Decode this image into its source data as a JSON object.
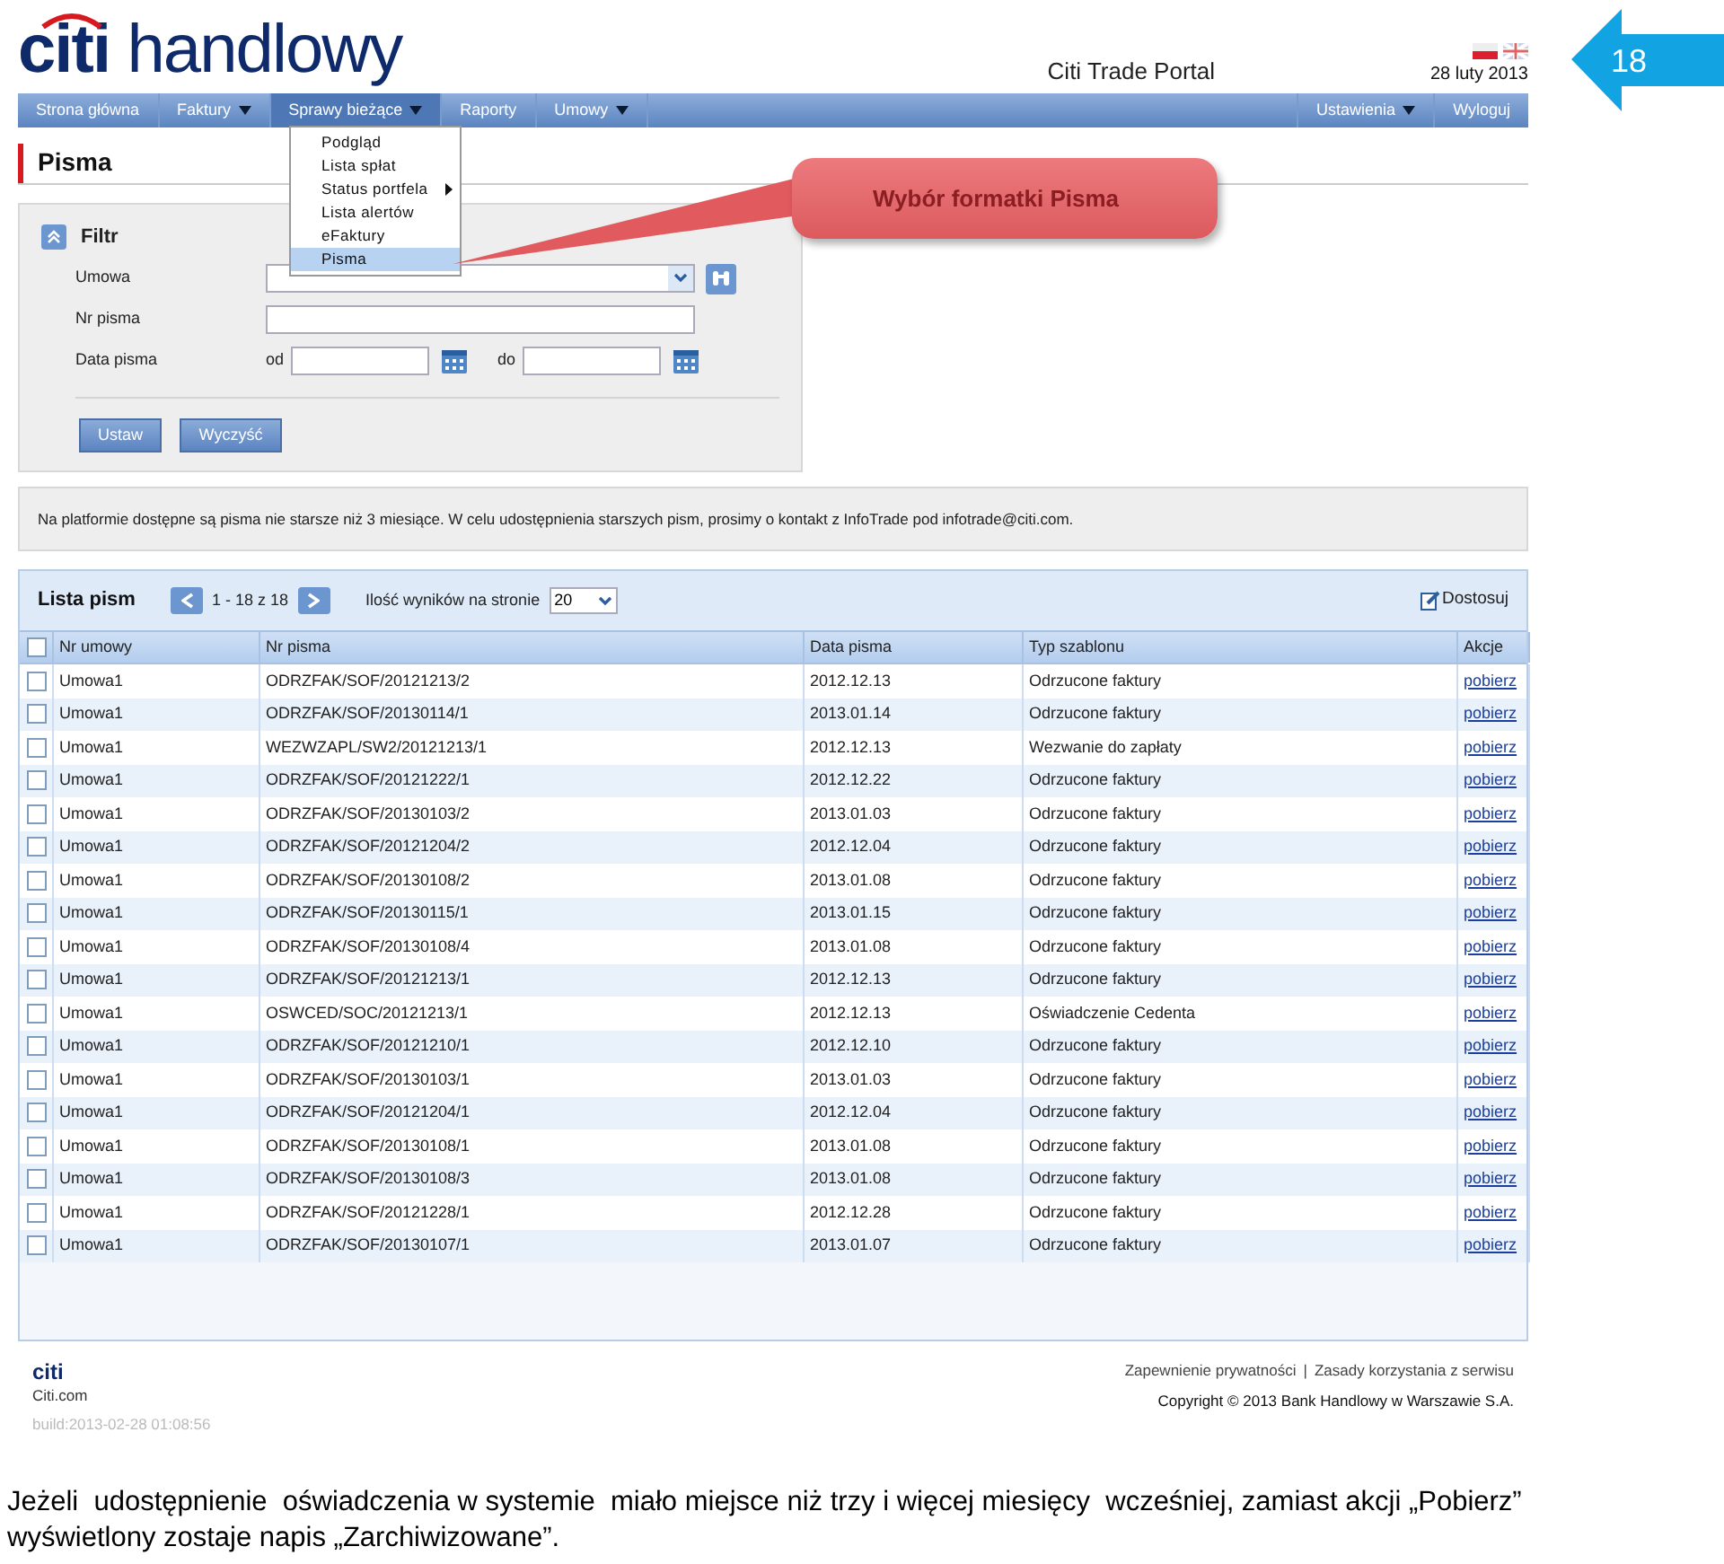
{
  "slide_number": "18",
  "logo": "**citi** handlowy",
  "portal_title": "Citi Trade Portal",
  "date": "28 luty 2013",
  "nav": [
    {
      "label": "Strona główna",
      "dropdown": false,
      "selected": false
    },
    {
      "label": "Faktury",
      "dropdown": true,
      "selected": false
    },
    {
      "label": "Sprawy bieżące",
      "dropdown": true,
      "selected": true
    },
    {
      "label": "Raporty",
      "dropdown": false,
      "selected": false
    },
    {
      "label": "Umowy",
      "dropdown": true,
      "selected": false
    }
  ],
  "nav_right": [
    {
      "label": "Ustawienia",
      "dropdown": true
    },
    {
      "label": "Wyloguj",
      "dropdown": false
    }
  ],
  "menu": [
    {
      "label": "Podgląd",
      "submenu": false,
      "selected": false
    },
    {
      "label": "Lista spłat",
      "submenu": false,
      "selected": false
    },
    {
      "label": "Status portfela",
      "submenu": true,
      "selected": false
    },
    {
      "label": "Lista alertów",
      "submenu": false,
      "selected": false
    },
    {
      "label": "eFaktury",
      "submenu": false,
      "selected": false
    },
    {
      "label": "Pisma",
      "submenu": false,
      "selected": true
    }
  ],
  "callout": "Wybór formatki Pisma",
  "page_title": "Pisma",
  "filter": {
    "title": "Filtr",
    "umowa_label": "Umowa",
    "nr_label": "Nr pisma",
    "date_label": "Data pisma",
    "from_label": "od",
    "to_label": "do",
    "buttons": [
      "Ustaw",
      "Wyczyść"
    ]
  },
  "info": "Na platformie dostępne są pisma nie starsze niż 3 miesiące. W celu udostępnienia starszych pism, prosimy o kontakt z InfoTrade pod infotrade@citi.com.",
  "list": {
    "title": "Lista pism",
    "range": "1 - 18 z 18",
    "per_page_label": "Ilość wyników na stronie",
    "per_page": "20",
    "customize": "Dostosuj",
    "select_all_checked": false,
    "columns": [
      "Nr umowy",
      "Nr pisma",
      "Data pisma",
      "Typ szablonu",
      "Akcje"
    ],
    "rows": [
      {
        "checked": false,
        "cells": [
          "Umowa1",
          "ODRZFAK/SOF/20121213/2",
          "2012.12.13",
          "Odrzucone faktury",
          "pobierz"
        ]
      },
      {
        "checked": false,
        "cells": [
          "Umowa1",
          "ODRZFAK/SOF/20130114/1",
          "2013.01.14",
          "Odrzucone faktury",
          "pobierz"
        ]
      },
      {
        "checked": false,
        "cells": [
          "Umowa1",
          "WEZWZAPL/SW2/20121213/1",
          "2012.12.13",
          "Wezwanie do zapłaty",
          "pobierz"
        ]
      },
      {
        "checked": false,
        "cells": [
          "Umowa1",
          "ODRZFAK/SOF/20121222/1",
          "2012.12.22",
          "Odrzucone faktury",
          "pobierz"
        ]
      },
      {
        "checked": false,
        "cells": [
          "Umowa1",
          "ODRZFAK/SOF/20130103/2",
          "2013.01.03",
          "Odrzucone faktury",
          "pobierz"
        ]
      },
      {
        "checked": false,
        "cells": [
          "Umowa1",
          "ODRZFAK/SOF/20121204/2",
          "2012.12.04",
          "Odrzucone faktury",
          "pobierz"
        ]
      },
      {
        "checked": false,
        "cells": [
          "Umowa1",
          "ODRZFAK/SOF/20130108/2",
          "2013.01.08",
          "Odrzucone faktury",
          "pobierz"
        ]
      },
      {
        "checked": false,
        "cells": [
          "Umowa1",
          "ODRZFAK/SOF/20130115/1",
          "2013.01.15",
          "Odrzucone faktury",
          "pobierz"
        ]
      },
      {
        "checked": false,
        "cells": [
          "Umowa1",
          "ODRZFAK/SOF/20130108/4",
          "2013.01.08",
          "Odrzucone faktury",
          "pobierz"
        ]
      },
      {
        "checked": false,
        "cells": [
          "Umowa1",
          "ODRZFAK/SOF/20121213/1",
          "2012.12.13",
          "Odrzucone faktury",
          "pobierz"
        ]
      },
      {
        "checked": false,
        "cells": [
          "Umowa1",
          "OSWCED/SOC/20121213/1",
          "2012.12.13",
          "Oświadczenie Cedenta",
          "pobierz"
        ]
      },
      {
        "checked": false,
        "cells": [
          "Umowa1",
          "ODRZFAK/SOF/20121210/1",
          "2012.12.10",
          "Odrzucone faktury",
          "pobierz"
        ]
      },
      {
        "checked": false,
        "cells": [
          "Umowa1",
          "ODRZFAK/SOF/20130103/1",
          "2013.01.03",
          "Odrzucone faktury",
          "pobierz"
        ]
      },
      {
        "checked": false,
        "cells": [
          "Umowa1",
          "ODRZFAK/SOF/20121204/1",
          "2012.12.04",
          "Odrzucone faktury",
          "pobierz"
        ]
      },
      {
        "checked": false,
        "cells": [
          "Umowa1",
          "ODRZFAK/SOF/20130108/1",
          "2013.01.08",
          "Odrzucone faktury",
          "pobierz"
        ]
      },
      {
        "checked": false,
        "cells": [
          "Umowa1",
          "ODRZFAK/SOF/20130108/3",
          "2013.01.08",
          "Odrzucone faktury",
          "pobierz"
        ]
      },
      {
        "checked": false,
        "cells": [
          "Umowa1",
          "ODRZFAK/SOF/20121228/1",
          "2012.12.28",
          "Odrzucone faktury",
          "pobierz"
        ]
      },
      {
        "checked": false,
        "cells": [
          "Umowa1",
          "ODRZFAK/SOF/20130107/1",
          "2013.01.07",
          "Odrzucone faktury",
          "pobierz"
        ]
      }
    ]
  },
  "footer": {
    "logo": "citi",
    "site": "Citi.com",
    "build": "build:2013-02-28 01:08:56",
    "links": [
      "Zapewnienie prywatności",
      "Zasady korzystania z serwisu"
    ],
    "separator": "|",
    "copyright": "Copyright © 2013 Bank Handlowy w Warszawie S.A."
  },
  "caption": "Jeżeli  udostępnienie  oświadczenia w systemie  miało miejsce niż trzy i więcej miesięcy  wcześniej, zamiast akcji „Pobierz” wyświetlony zostaje napis „Zarchiwizowane”."
}
